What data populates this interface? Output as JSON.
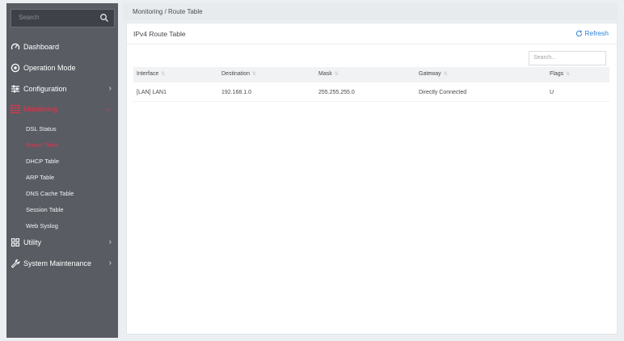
{
  "sidebar": {
    "search_placeholder": "Search",
    "items": [
      {
        "label": "Dashboard",
        "icon": "dashboard-icon"
      },
      {
        "label": "Operation Mode",
        "icon": "operation-mode-icon"
      },
      {
        "label": "Configuration",
        "icon": "configuration-icon"
      },
      {
        "label": "Monitoring",
        "icon": "monitoring-icon"
      },
      {
        "label": "Utility",
        "icon": "utility-icon"
      },
      {
        "label": "System Maintenance",
        "icon": "wrench-icon"
      }
    ],
    "monitoring_sub": [
      "DSL Status",
      "Route Table",
      "DHCP Table",
      "ARP Table",
      "DNS Cache Table",
      "Session Table",
      "Web Syslog"
    ]
  },
  "breadcrumb": "Monitoring / Route Table",
  "panel": {
    "title": "IPv4 Route Table",
    "refresh_label": "Refresh",
    "search_placeholder": "Search..."
  },
  "table": {
    "columns": [
      "Interface",
      "Destination",
      "Mask",
      "Gateway",
      "Flags"
    ],
    "rows": [
      [
        "[LAN] LAN1",
        "192.168.1.0",
        "255.255.255.0",
        "Directly Connected",
        "U"
      ]
    ]
  },
  "colors": {
    "sidebar_bg": "#595c63",
    "active": "#e0344d",
    "accent": "#2f7fd6"
  }
}
